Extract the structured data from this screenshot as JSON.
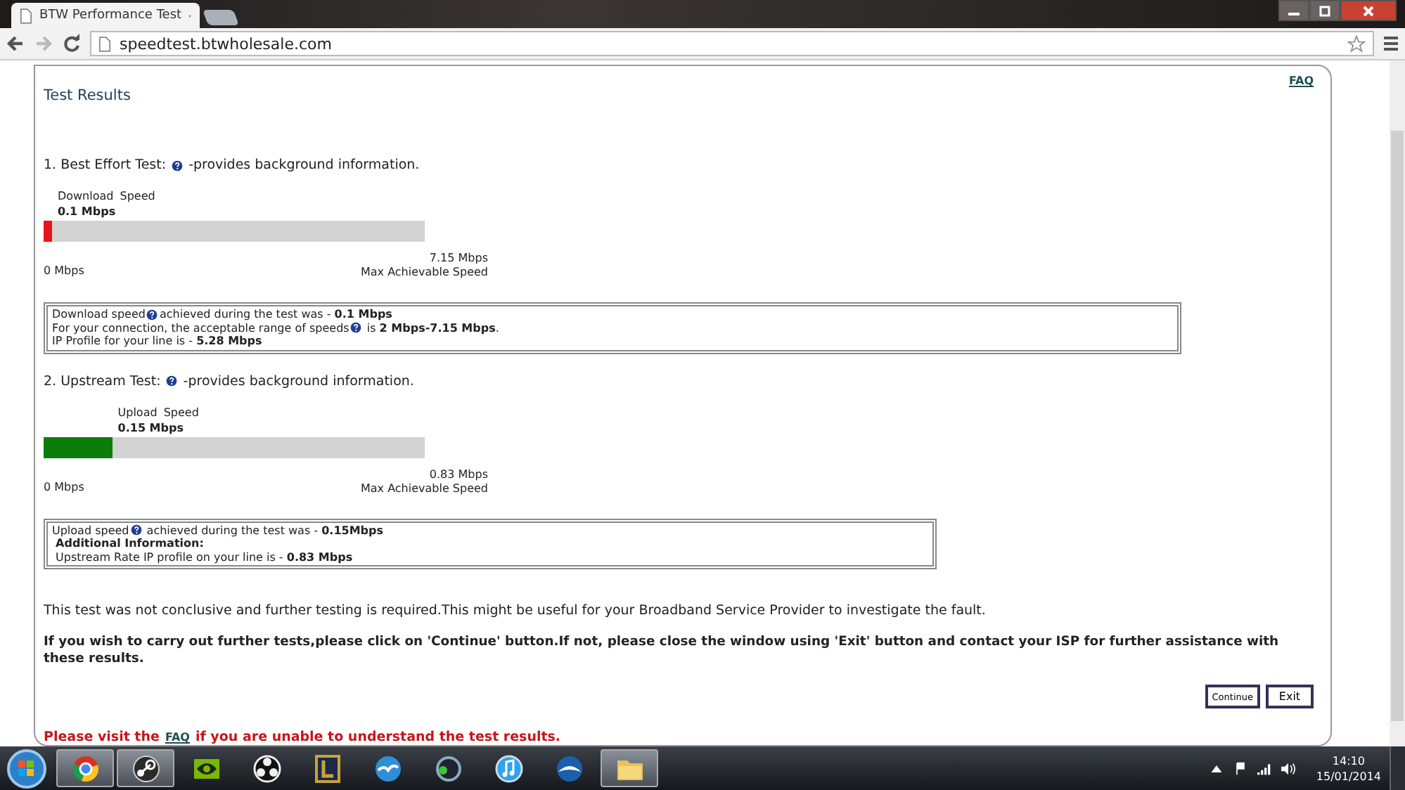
{
  "browser": {
    "tab_title": "BTW Performance Test",
    "address": "speedtest.btwholesale.com"
  },
  "page": {
    "faq_link": "FAQ",
    "heading": "Test Results",
    "tests": [
      {
        "title": "1. Best Effort Test:",
        "note": "-provides background information.",
        "meter_label": "Download  Speed",
        "value": "0.1 Mbps",
        "level": 0.022,
        "color": "#e8141b",
        "min_label": "0 Mbps",
        "max_value": "7.15 Mbps",
        "max_label": "Max Achievable Speed",
        "info": [
          {
            "before": "Download speed",
            "after": "achieved during the test was - **0.1 Mbps**"
          },
          {
            "before": "For your connection, the acceptable range of speeds",
            "after": " is **2 Mbps-7.15 Mbps**."
          },
          {
            "before": "IP Profile for your line is - **5.28 Mbps**"
          }
        ]
      },
      {
        "title": "2. Upstream Test:",
        "note": "-provides background information.",
        "meter_label": "Upload Speed",
        "value": "0.15 Mbps",
        "level": 0.18,
        "color": "#0a7d0a",
        "min_label": "0 Mbps",
        "max_value": "0.83 Mbps",
        "max_label": "Max Achievable Speed",
        "info": [
          {
            "before": "Upload speed",
            "after": " achieved during the test was - **0.15Mbps**"
          },
          {
            "before": " **Additional Information:**"
          },
          {
            "before": " Upstream Rate IP profile on your line is - **0.83 Mbps**"
          }
        ]
      }
    ],
    "conclusion": "This test was not conclusive and further testing is required.This might be useful for your Broadband Service Provider to investigate the fault.",
    "instruction": "If you wish to carry out further tests,please click on 'Continue' button.If not, please close the window using 'Exit' button and contact your ISP for further assistance with these results.",
    "buttons": [
      "Continue",
      "Exit"
    ],
    "footer": {
      "before": "Please visit the",
      "link": "FAQ",
      "after": "if you are unable to understand the test results."
    }
  },
  "taskbar": {
    "items": [
      {
        "running": true
      },
      {
        "running": true
      },
      {
        "running": false
      },
      {
        "running": false
      },
      {
        "running": false
      },
      {
        "running": false
      },
      {
        "running": false
      },
      {
        "running": false
      },
      {
        "running": false
      },
      {
        "running": true
      }
    ],
    "time": "14:10",
    "date": "15/01/2014"
  }
}
